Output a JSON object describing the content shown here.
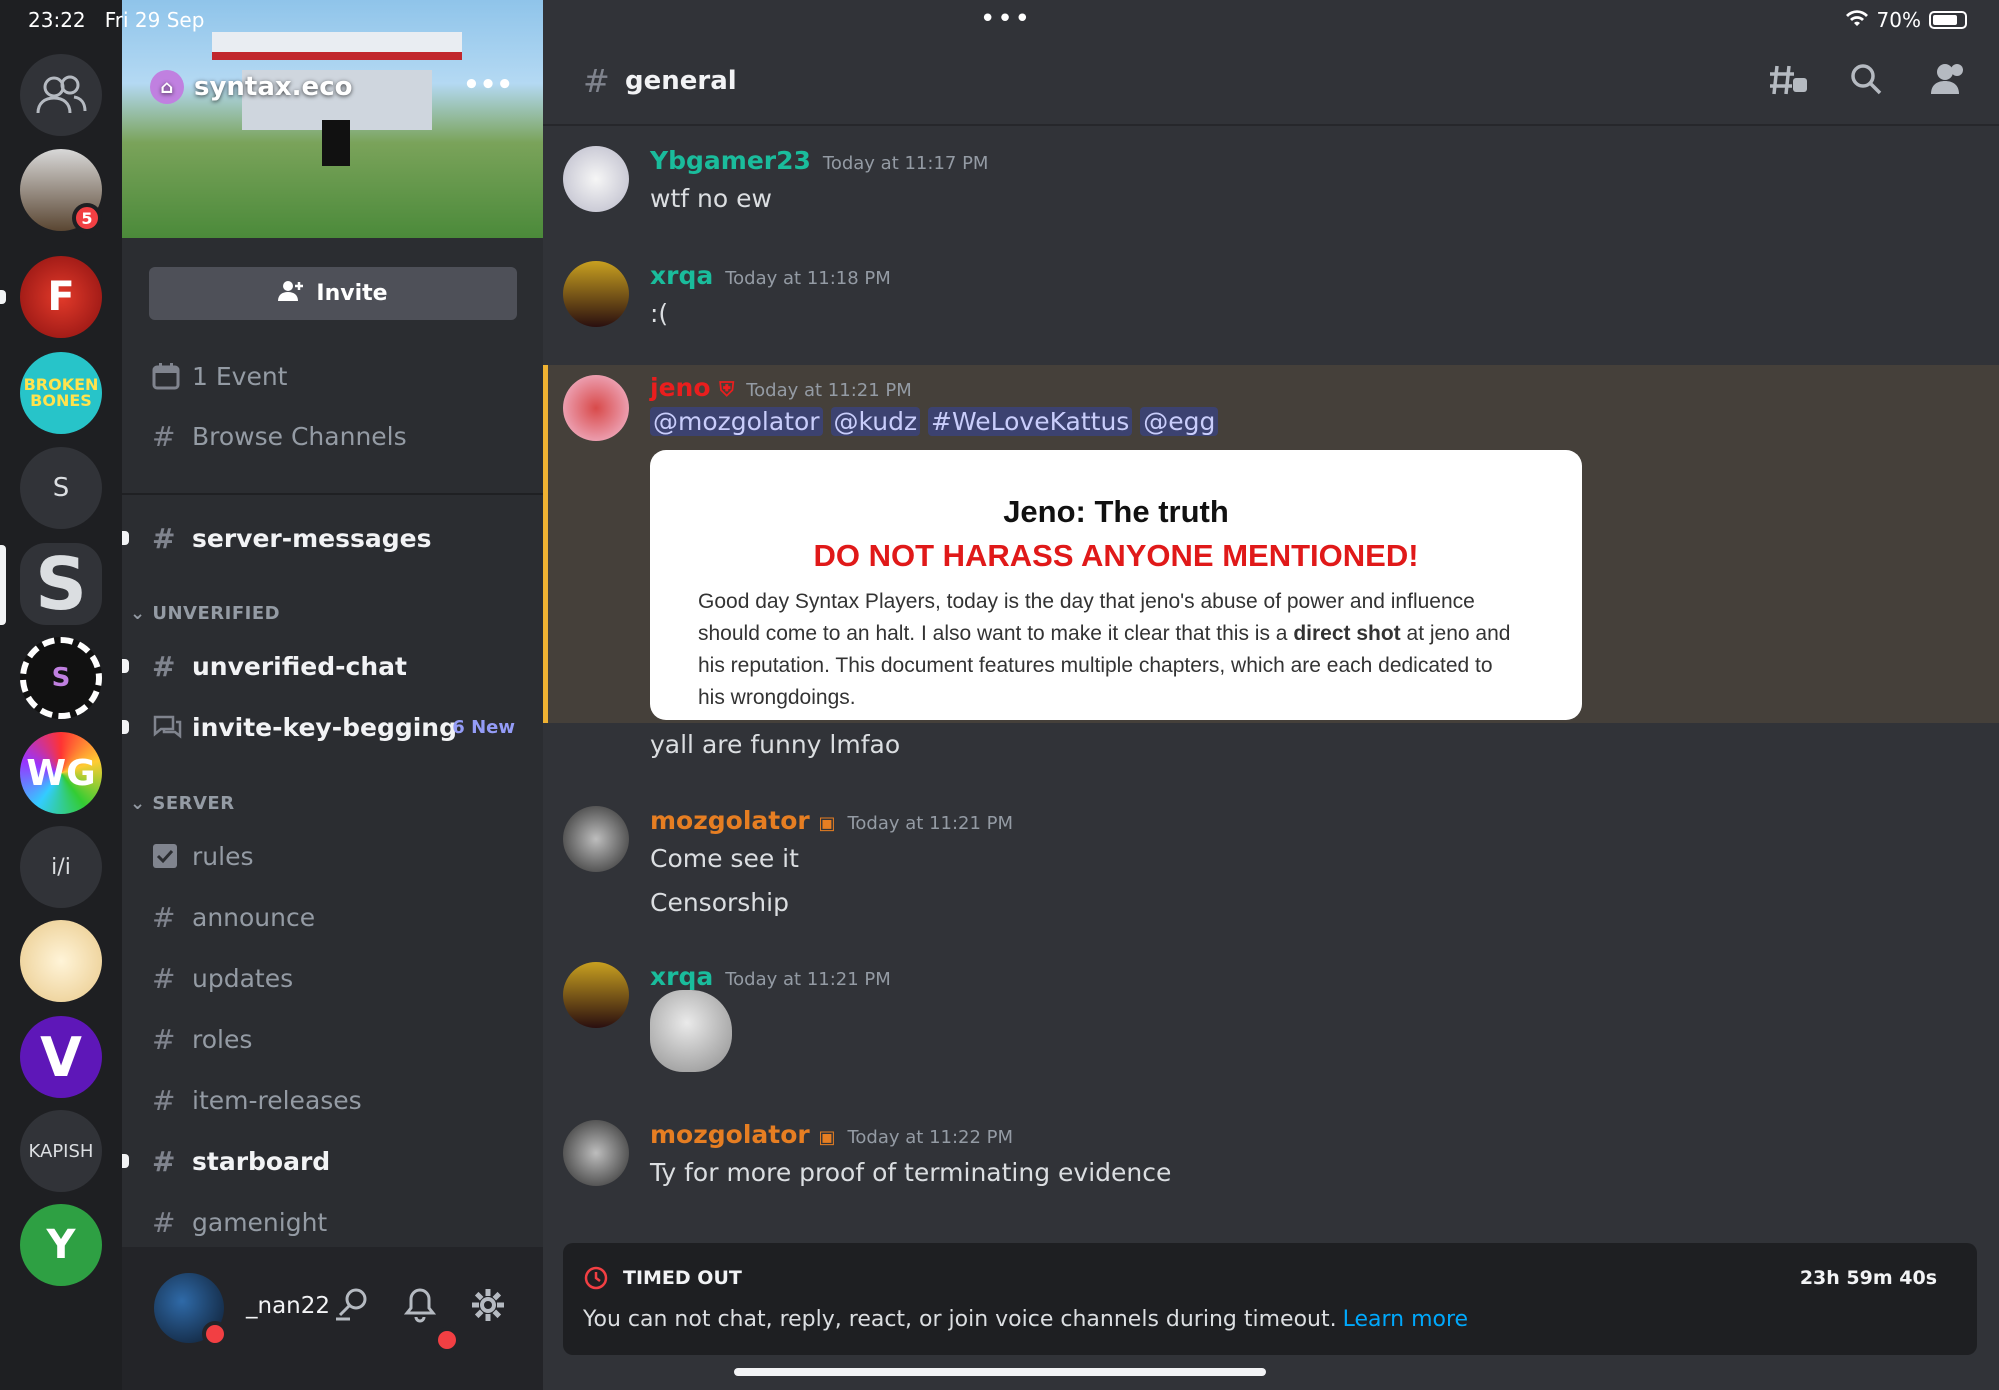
{
  "status_bar": {
    "time": "23:22",
    "date": "Fri 29 Sep",
    "battery": "70%",
    "battery_level": 0.7
  },
  "rail": {
    "servers": [
      {
        "name": "direct-messages",
        "label": ""
      },
      {
        "name": "server-avatar-1",
        "label": "",
        "badge": "5"
      },
      {
        "name": "server-f",
        "label": "F"
      },
      {
        "name": "server-broken-bones",
        "label": "BROKEN BONES"
      },
      {
        "name": "server-s",
        "label": "S"
      },
      {
        "name": "server-syntax",
        "label": "S"
      },
      {
        "name": "server-poker-s",
        "label": "S"
      },
      {
        "name": "server-wg",
        "label": "WG"
      },
      {
        "name": "server-ii",
        "label": "i/i"
      },
      {
        "name": "server-anime",
        "label": ""
      },
      {
        "name": "server-v",
        "label": "V"
      },
      {
        "name": "server-kapish",
        "label": "KAPISH"
      },
      {
        "name": "server-y",
        "label": "Y"
      }
    ]
  },
  "sidebar": {
    "server_name": "syntax.eco",
    "invite_label": "Invite",
    "event_label": "1 Event",
    "browse_label": "Browse Channels",
    "top_channel": "server-messages",
    "category_unverified": "UNVERIFIED",
    "unverified_chat": "unverified-chat",
    "invite_key_begging": "invite-key-begging",
    "invite_key_new": "6 New",
    "category_server": "SERVER",
    "channels": {
      "rules": "rules",
      "announce": "announce",
      "updates": "updates",
      "roles": "roles",
      "item_releases": "item-releases",
      "starboard": "starboard",
      "gamenight": "gamenight"
    },
    "username": "_nan22"
  },
  "chat": {
    "channel_name": "general",
    "messages": [
      {
        "author": "Ybgamer23",
        "color": "#1abc9c",
        "time": "Today at 11:17 PM",
        "text": "wtf no ew"
      },
      {
        "author": "xrqa",
        "color": "#1abc9c",
        "time": "Today at 11:18 PM",
        "text": ":("
      },
      {
        "author": "jeno",
        "color": "#e91e1e",
        "time": "Today at 11:21 PM",
        "mentions": [
          "@mozgolator",
          "@kudz",
          "#WeLoveKattus",
          "@egg"
        ]
      },
      {
        "text": "yall are funny lmfao"
      },
      {
        "author": "mozgolator",
        "color": "#e67e22",
        "time": "Today at 11:21 PM",
        "text": "Come see it",
        "text2": "Censorship"
      },
      {
        "author": "xrqa",
        "color": "#1abc9c",
        "time": "Today at 11:21 PM"
      },
      {
        "author": "mozgolator",
        "color": "#e67e22",
        "time": "Today at 11:22 PM",
        "text": "Ty for more proof of terminating evidence"
      }
    ],
    "document": {
      "title": "Jeno: The truth",
      "warning": "DO NOT HARASS ANYONE MENTIONED!",
      "body_before": "Good day Syntax Players, today is the day that jeno's abuse of power and influence should come to an halt. I also want to make it clear that this is a",
      "body_bold": "direct shot",
      "body_after": "at jeno and his reputation. This document features multiple chapters, which are each dedicated to his wrongdoings."
    },
    "timeout": {
      "title": "TIMED OUT",
      "countdown": "23h 59m 40s",
      "description": "You can not chat, reply, react, or join voice channels during timeout.",
      "link": "Learn more"
    }
  },
  "colors": {
    "accent": "#5865f2",
    "highlight": "#f0b232",
    "danger": "#f23f43",
    "link": "#00a8fc"
  }
}
